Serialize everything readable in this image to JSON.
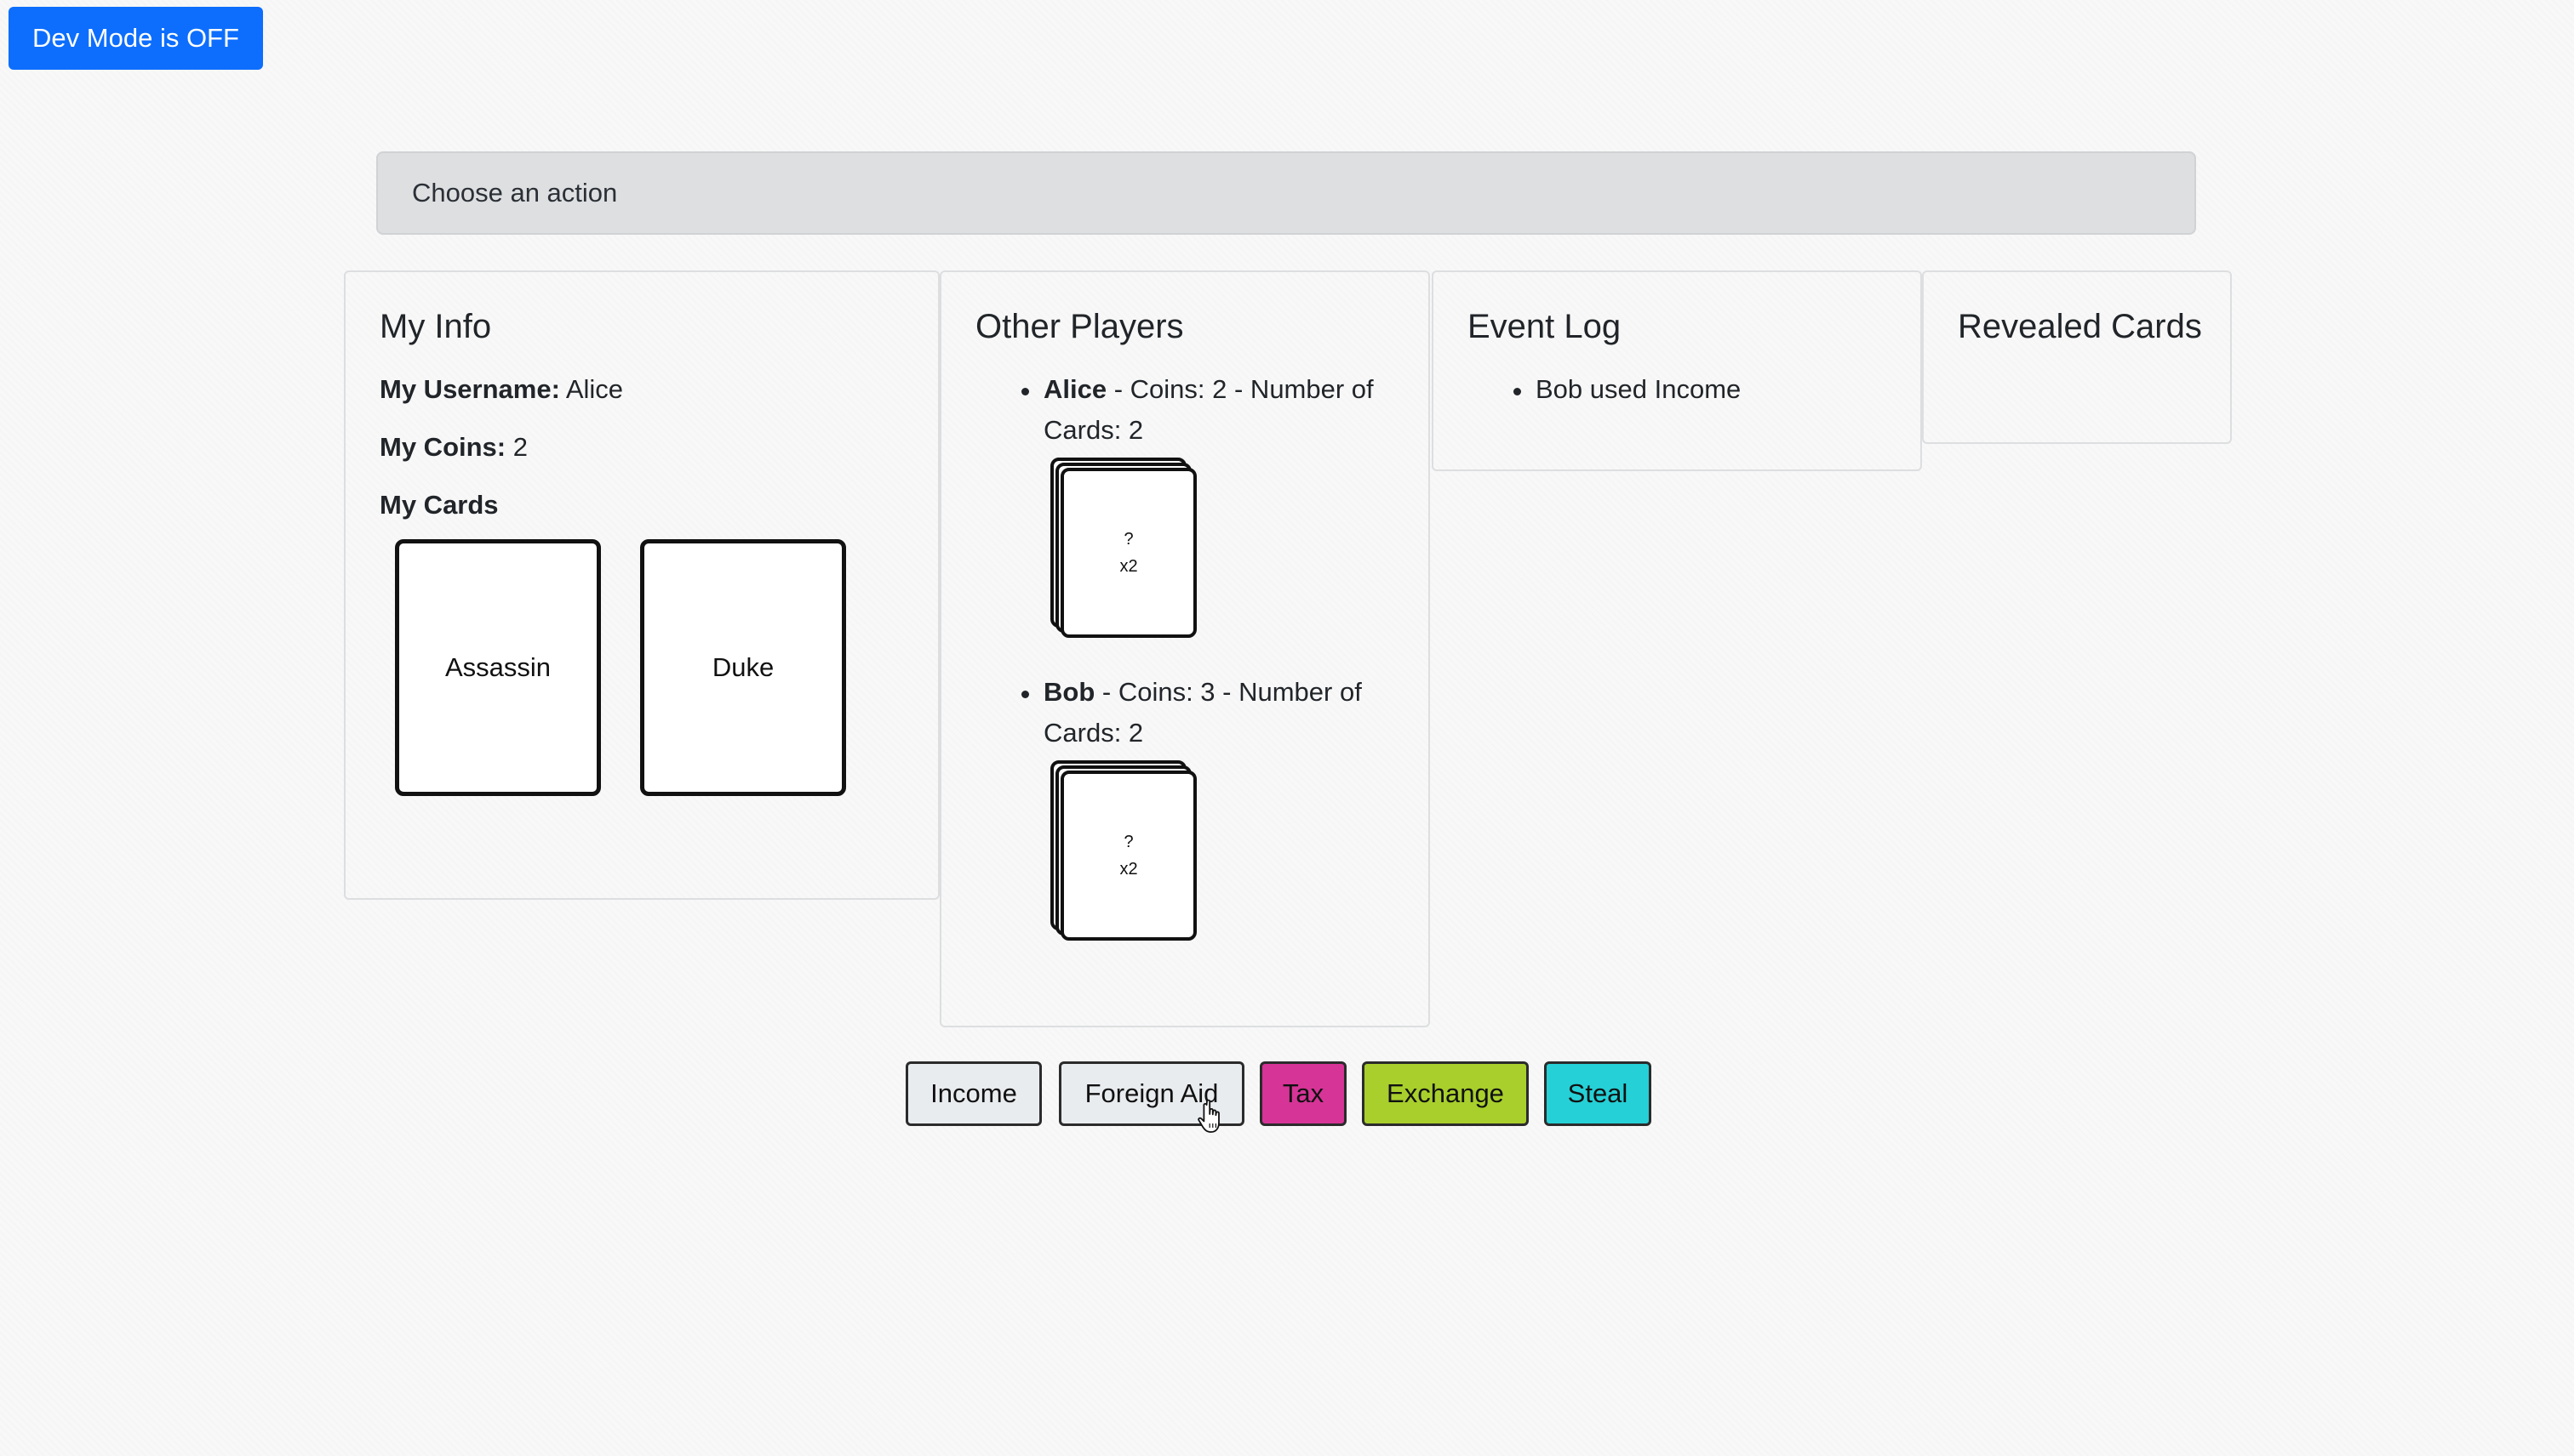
{
  "dev_mode": {
    "label": "Dev Mode is OFF"
  },
  "action_banner": {
    "text": "Choose an action"
  },
  "my_info": {
    "title": "My Info",
    "username_label": "My Username:",
    "username": "Alice",
    "coins_label": "My Coins:",
    "coins": "2",
    "cards_label": "My Cards",
    "cards": [
      "Assassin",
      "Duke"
    ]
  },
  "other_players": {
    "title": "Other Players",
    "players": [
      {
        "name": "Alice",
        "details": " - Coins: 2 - Number of Cards: 2",
        "card_symbol": "?",
        "card_count": "x2"
      },
      {
        "name": "Bob",
        "details": " - Coins: 3 - Number of Cards: 2",
        "card_symbol": "?",
        "card_count": "x2"
      }
    ]
  },
  "event_log": {
    "title": "Event Log",
    "entries": [
      "Bob used Income"
    ]
  },
  "revealed_cards": {
    "title": "Revealed Cards"
  },
  "actions": {
    "buttons": [
      {
        "label": "Income",
        "color": "#e9ecef"
      },
      {
        "label": "Foreign Aid",
        "color": "#e9ecef"
      },
      {
        "label": "Tax",
        "color": "#d63497"
      },
      {
        "label": "Exchange",
        "color": "#a8cf2c"
      },
      {
        "label": "Steal",
        "color": "#25d0d6"
      }
    ]
  },
  "colors": {
    "dev_button": "#0d6efd",
    "banner_bg": "#dedfe1"
  }
}
